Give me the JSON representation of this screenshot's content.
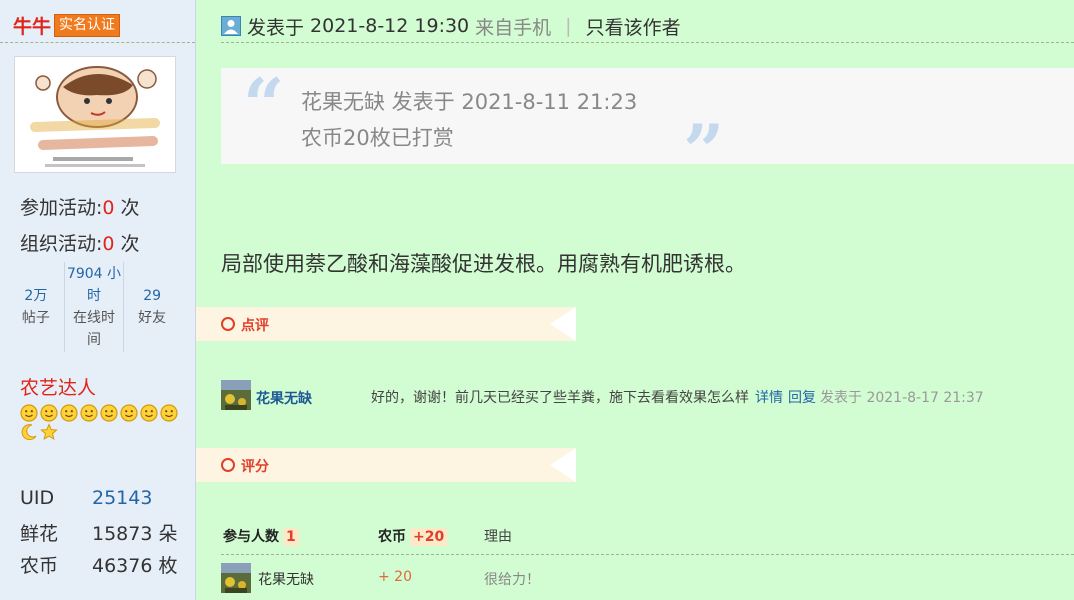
{
  "sidebar": {
    "username": "牛牛",
    "verified_badge": "实名认证",
    "activities": [
      {
        "label": "参加活动:",
        "count": "0",
        "unit": " 次"
      },
      {
        "label": "组织活动:",
        "count": "0",
        "unit": " 次"
      }
    ],
    "stats": [
      {
        "value": "2万",
        "label": "帖子"
      },
      {
        "value": "7904 小时",
        "label": "在线时间"
      },
      {
        "value": "29",
        "label": "好友"
      }
    ],
    "user_group": "农艺达人",
    "rank_icons": [
      "smiley-icon",
      "smiley-icon",
      "smiley-icon",
      "smiley-icon",
      "smiley-icon",
      "smiley-icon",
      "smiley-icon",
      "smiley-icon",
      "moon-icon",
      "star-icon"
    ],
    "profile": [
      {
        "key": "UID",
        "value": "25143",
        "unit": ""
      },
      {
        "key": "鲜花",
        "value": "15873",
        "unit": " 朵"
      },
      {
        "key": "农币",
        "value": "46376",
        "unit": " 枚"
      }
    ]
  },
  "post": {
    "posted_prefix": "发表于",
    "posted_time": "2021-8-12 19:30",
    "source": "来自手机",
    "separator": "|",
    "only_author": "只看该作者",
    "quote": {
      "line1": "花果无缺 发表于 2021-8-11 21:23",
      "line2": "农币20枚已打赏"
    },
    "content": "局部使用萘乙酸和海藻酸促进发根。用腐熟有机肥诱根。"
  },
  "comments_section": {
    "title": "点评",
    "items": [
      {
        "author": "花果无缺",
        "text": "好的，谢谢！前几天已经买了些羊粪，施下去看看效果怎么样",
        "detail_link": "详情",
        "reply_link": "回复",
        "time": "发表于 2021-8-17 21:37"
      }
    ]
  },
  "rating_section": {
    "title": "评分",
    "participants_label": "参与人数",
    "participants_count": "1",
    "coin_label": "农币",
    "coin_total": "+20",
    "reason_label": "理由",
    "rows": [
      {
        "user": "花果无缺",
        "coins": "+ 20",
        "reason": "很给力！"
      }
    ]
  },
  "colors": {
    "accent_red": "#e0251b",
    "link_blue": "#2366a8",
    "post_bg": "#d2fcd1",
    "sidebar_bg": "#e6eef7"
  }
}
